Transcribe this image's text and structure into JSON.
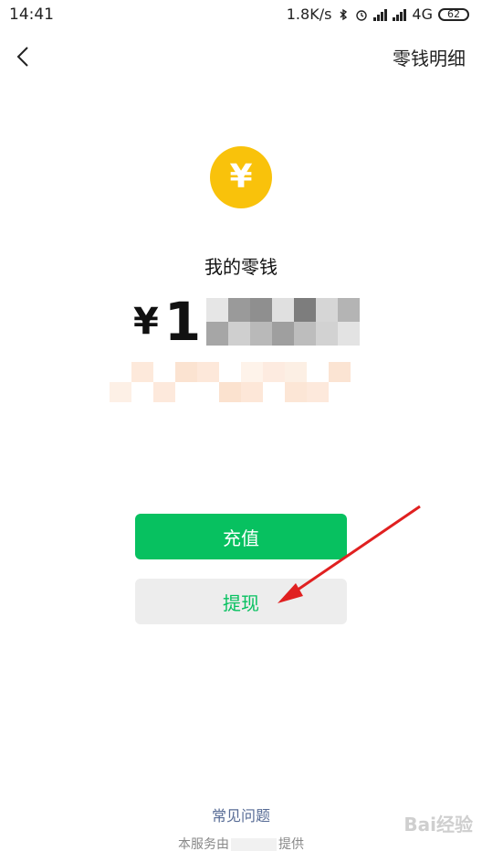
{
  "status_bar": {
    "time": "14:41",
    "net_speed": "1.8K/s",
    "network": "4G",
    "battery": "62"
  },
  "nav": {
    "title": "零钱明细"
  },
  "wallet": {
    "coin_symbol": "¥",
    "title": "我的零钱",
    "currency_symbol": "¥",
    "amount_first_digit": "1"
  },
  "actions": {
    "recharge_label": "充值",
    "withdraw_label": "提现"
  },
  "links": {
    "faq_label": "常见问题"
  },
  "footer": {
    "prefix": "本服务由",
    "suffix": "提供"
  },
  "watermark": {
    "text": "Bai经验"
  },
  "colors": {
    "accent_green": "#07C160",
    "coin_yellow": "#F9C20B",
    "link_blue": "#576B95",
    "annotation_red": "#E02020"
  }
}
